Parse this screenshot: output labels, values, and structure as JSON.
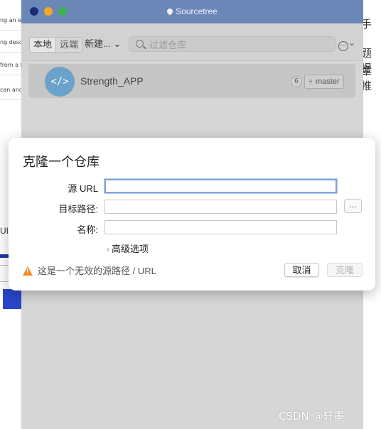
{
  "background": {
    "snippets": [
      "ng an ex",
      "ng desc",
      "from a li",
      "can and"
    ],
    "right_text": [
      "手",
      "题提",
      "章推"
    ],
    "partial_ui_text": "UI"
  },
  "window": {
    "title": "Sourcetree",
    "toolbar": {
      "tab_local": "本地",
      "tab_remote": "远端",
      "new_button": "新建...",
      "new_chevron": "⌄",
      "search_placeholder": "过滤仓库",
      "more_chevron": "⌄"
    },
    "repo": {
      "name": "Strength_APP",
      "icon_text": "</>",
      "count": "6",
      "branch": "master"
    }
  },
  "dialog": {
    "title": "克隆一个仓库",
    "fields": {
      "source_url_label": "源 URL",
      "source_url_value": "",
      "target_path_label": "目标路径:",
      "target_path_value": "",
      "name_label": "名称:",
      "name_value": ""
    },
    "browse_label": "...",
    "advanced_label": "高级选项",
    "warning_text": "这是一个无效的源路径 / URL",
    "cancel_label": "取消",
    "clone_label": "克隆"
  },
  "watermark": "CSDN @轩墨",
  "colors": {
    "titlebar": "#6b87b8",
    "warning": "#f08a24",
    "focus": "#7fa3d9",
    "repo_icon": "#6aa2c9"
  }
}
